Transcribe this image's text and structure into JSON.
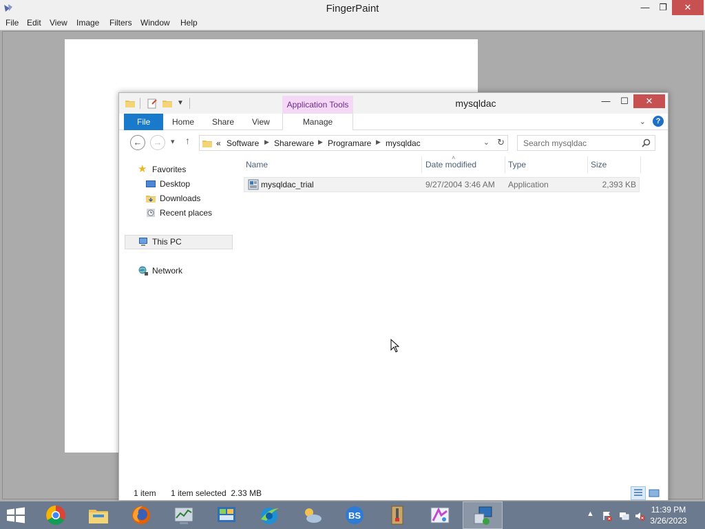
{
  "fingerpaint": {
    "title": "FingerPaint",
    "menu": [
      "File",
      "Edit",
      "View",
      "Image",
      "Filters",
      "Window",
      "Help"
    ]
  },
  "explorer": {
    "title": "mysqldac",
    "context_tab": "Application Tools",
    "ribbon_tabs": [
      "File",
      "Home",
      "Share",
      "View"
    ],
    "manage_tab": "Manage",
    "address": {
      "overflow": "«",
      "segments": [
        "Software",
        "Shareware",
        "Programare",
        "mysqldac"
      ]
    },
    "search": {
      "placeholder": "Search mysqldac"
    },
    "nav_pane": {
      "favorites": "Favorites",
      "desktop": "Desktop",
      "downloads": "Downloads",
      "recent": "Recent places",
      "this_pc": "This PC",
      "network": "Network"
    },
    "columns": {
      "name": "Name",
      "date": "Date modified",
      "type": "Type",
      "size": "Size"
    },
    "files": [
      {
        "name": "mysqldac_trial",
        "date": "9/27/2004 3:46 AM",
        "type": "Application",
        "size": "2,393 KB"
      }
    ],
    "status": {
      "count": "1 item",
      "selected": "1 item selected  2.33 MB"
    }
  },
  "taskbar": {
    "apps": [
      "chrome-icon",
      "file-explorer-icon",
      "firefox-icon",
      "task-manager-icon",
      "control-panel-icon",
      "internet-explorer-icon",
      "weather-icon",
      "bluestacks-icon",
      "archive-icon",
      "paint-icon",
      "network-setup-icon"
    ],
    "clock_time": "11:39 PM",
    "clock_date": "3/26/2023"
  },
  "colors": {
    "accent": "#1979ca",
    "context_tab_bg": "#f5d8f5",
    "taskbar": "#6b7a8e"
  }
}
